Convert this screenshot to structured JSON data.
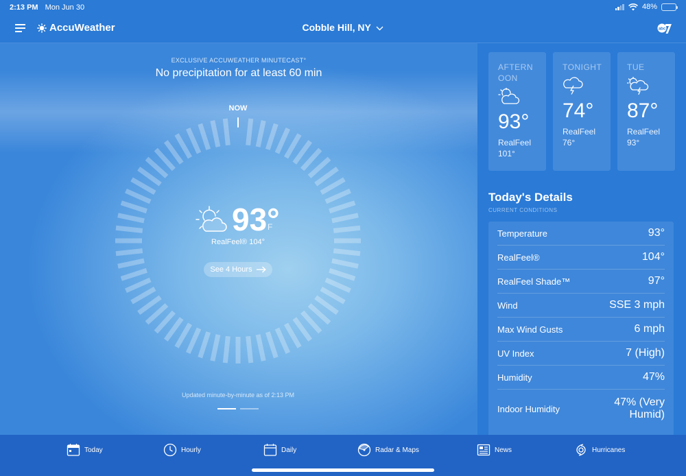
{
  "status_bar": {
    "time": "2:13 PM",
    "date": "Mon Jun 30",
    "battery": "48%",
    "battery_level": 0.48
  },
  "header": {
    "app_name": "AccuWeather",
    "location": "Cobble Hill, NY",
    "location_chevron": "chevron-down-icon"
  },
  "minutecast": {
    "label": "EXCLUSIVE ACCUWEATHER MINUTECAST°",
    "summary": "No precipitation for at least 60 min",
    "now_label": "NOW",
    "updated": "Updated minute-by-minute as of 2:13 PM"
  },
  "current": {
    "icon": "partly-sunny-icon",
    "temp": "93°",
    "unit": "F",
    "realfeel": "RealFeel® 104°",
    "see_hours": "See 4 Hours"
  },
  "forecast": [
    {
      "label": "AFTERNOON",
      "icon": "partly-cloudy-icon",
      "temp": "93°",
      "realfeel_label": "RealFeel",
      "realfeel_value": "101°"
    },
    {
      "label": "TONIGHT",
      "icon": "thunderstorm-icon",
      "temp": "74°",
      "realfeel_label": "RealFeel",
      "realfeel_value": "76°"
    },
    {
      "label": "TUE",
      "icon": "thunderstorm-sun-icon",
      "temp": "87°",
      "realfeel_label": "RealFeel",
      "realfeel_value": "93°"
    }
  ],
  "details": {
    "title": "Today's Details",
    "subtitle": "CURRENT CONDITIONS",
    "rows": [
      {
        "label": "Temperature",
        "value": "93°"
      },
      {
        "label": "RealFeel®",
        "value": "104°"
      },
      {
        "label": "RealFeel Shade™",
        "value": "97°"
      },
      {
        "label": "Wind",
        "value": "SSE 3 mph"
      },
      {
        "label": "Max Wind Gusts",
        "value": "6 mph"
      },
      {
        "label": "UV Index",
        "value": "7 (High)"
      },
      {
        "label": "Humidity",
        "value": "47%"
      },
      {
        "label": "Indoor Humidity",
        "value": "47% (Very Humid)"
      }
    ]
  },
  "nav": [
    {
      "label": "Today",
      "icon": "calendar-today-icon"
    },
    {
      "label": "Hourly",
      "icon": "clock-icon"
    },
    {
      "label": "Daily",
      "icon": "calendar-icon"
    },
    {
      "label": "Radar & Maps",
      "icon": "radar-icon"
    },
    {
      "label": "News",
      "icon": "newspaper-icon"
    },
    {
      "label": "Hurricanes",
      "icon": "hurricane-icon"
    }
  ]
}
